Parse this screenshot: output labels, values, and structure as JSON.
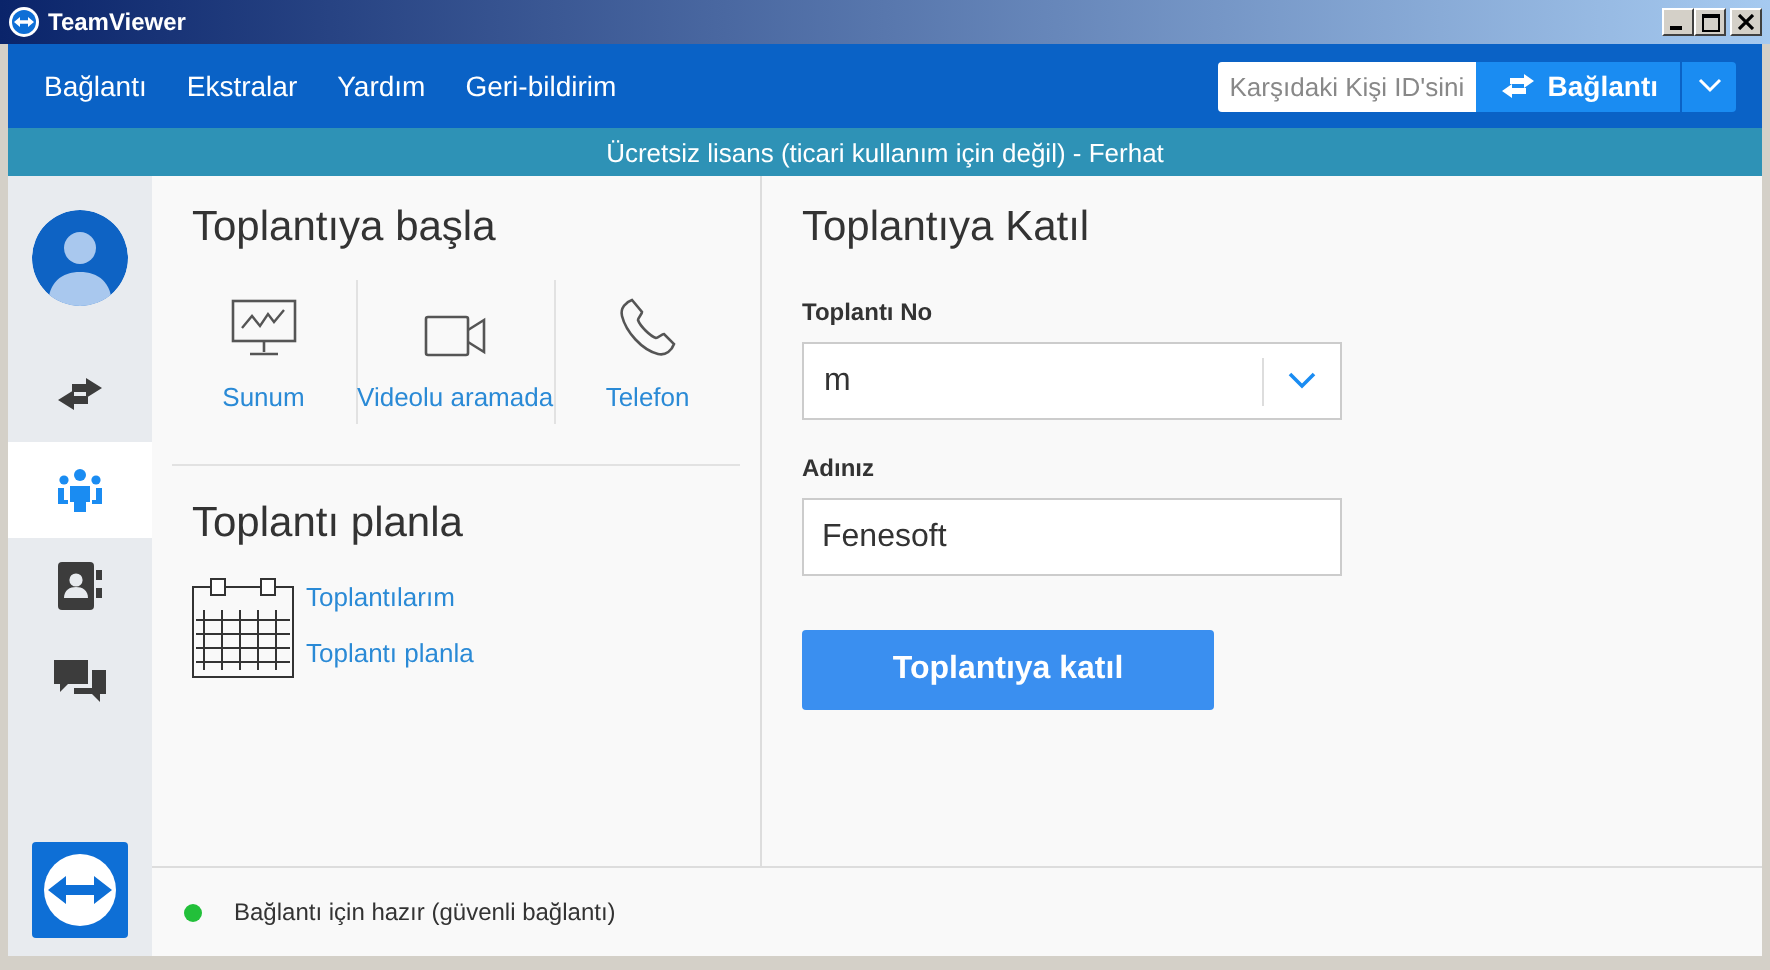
{
  "window": {
    "title": "TeamViewer"
  },
  "menu": [
    "Bağlantı",
    "Ekstralar",
    "Yardım",
    "Geri-bildirim"
  ],
  "partner_id": {
    "placeholder": "Karşıdaki Kişi ID'sini"
  },
  "connect_button": "Bağlantı",
  "license_bar": "Ücretsiz lisans (ticari kullanım için değil) - Ferhat",
  "sidebar": {
    "items": [
      {
        "kind": "remote",
        "selected": false
      },
      {
        "kind": "meeting",
        "selected": true
      },
      {
        "kind": "contacts",
        "selected": false
      },
      {
        "kind": "chat",
        "selected": false
      }
    ]
  },
  "start_meeting": {
    "title": "Toplantıya başla",
    "actions": [
      {
        "kind": "presentation",
        "label": "Sunum"
      },
      {
        "kind": "video",
        "label": "Videolu aramada"
      },
      {
        "kind": "phone",
        "label": "Telefon"
      }
    ]
  },
  "schedule": {
    "title": "Toplantı planla",
    "links": [
      "Toplantılarım",
      "Toplantı planla"
    ]
  },
  "join": {
    "title": "Toplantıya Katıl",
    "meeting_id": {
      "label": "Toplantı No",
      "value": "m"
    },
    "name": {
      "label": "Adınız",
      "value": "Fenesoft"
    },
    "button": "Toplantıya katıl"
  },
  "status_bar": {
    "text": "Bağlantı için hazır (güvenli bağlantı)",
    "color": "#22c03a"
  }
}
